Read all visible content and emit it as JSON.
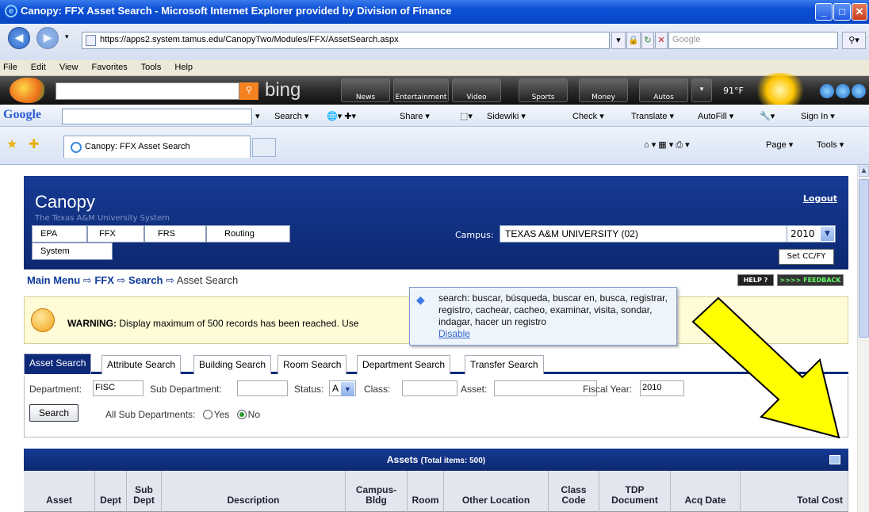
{
  "window": {
    "title": "Canopy: FFX Asset Search - Microsoft Internet Explorer provided by Division of Finance"
  },
  "address": {
    "url": "https://apps2.system.tamus.edu/CanopyTwo/Modules/FFX/AssetSearch.aspx",
    "search_placeholder": "Google"
  },
  "menubar": [
    "File",
    "Edit",
    "View",
    "Favorites",
    "Tools",
    "Help"
  ],
  "bing": {
    "word": "bing",
    "tabs": [
      "News",
      "Entertainment",
      "Video",
      "Sports",
      "Money",
      "Autos"
    ],
    "temperature": "91°F"
  },
  "google_toolbar": {
    "logo": "Google",
    "items": [
      "Search ▾",
      "Share ▾",
      "Sidewiki ▾",
      "Check ▾",
      "Translate ▾",
      "AutoFill ▾",
      "Sign In ▾"
    ]
  },
  "tabs": {
    "active_title": "Canopy: FFX Asset Search",
    "commands": [
      "Page ▾",
      "Tools ▾"
    ]
  },
  "canopy": {
    "title": "Canopy",
    "subtitle": "The Texas A&M University System",
    "logout": "Logout",
    "menu": [
      "EPA",
      "FFX",
      "FRS",
      "Routing",
      "System"
    ],
    "campus_label": "Campus:",
    "campus_value": "TEXAS A&M UNIVERSITY (02)",
    "fiscal_label": "Fiscal Year:",
    "fiscal_value": "2010",
    "set_button": "Set CC/FY"
  },
  "breadcrumb": {
    "main": "Main Menu",
    "ffx": "FFX",
    "search": "Search",
    "current": "Asset Search",
    "sep": "⇨"
  },
  "help": {
    "help": "HELP ?",
    "feedback": ">>>> FEEDBACK"
  },
  "warning": {
    "label": "WARNING:",
    "text": "Display maximum of 500 records has been reached. Use"
  },
  "tooltip": {
    "text": "search: buscar, búsqueda, buscar en, busca, registrar, registro, cachear, cacheo, examinar, visita, sondar, indagar, hacer un registro",
    "disable": "Disable"
  },
  "search_tabs": [
    "Asset Search",
    "Attribute Search",
    "Building Search",
    "Room Search",
    "Department Search",
    "Transfer Search"
  ],
  "form": {
    "department_label": "Department:",
    "department_value": "FISC",
    "subdept_label": "Sub Department:",
    "subdept_value": "",
    "status_label": "Status:",
    "status_value": "A",
    "class_label": "Class:",
    "class_value": "",
    "asset_label": "Asset:",
    "asset_value": "",
    "fy_label": "Fiscal Year:",
    "fy_value": "2010",
    "search_button": "Search",
    "allsub_label": "All Sub Departments:",
    "yes": "Yes",
    "no": "No",
    "selected": "No"
  },
  "assets": {
    "title": "Assets",
    "count": "(Total items: 500)",
    "columns": [
      "Asset",
      "Dept",
      "Sub\nDept",
      "Description",
      "Campus-\nBldg",
      "Room",
      "Other Location",
      "Class\nCode",
      "TDP\nDocument",
      "Acq Date",
      "Total Cost"
    ]
  },
  "colors": {
    "canopy_blue": "#0d2a7a",
    "arrow": "#ffff00"
  }
}
